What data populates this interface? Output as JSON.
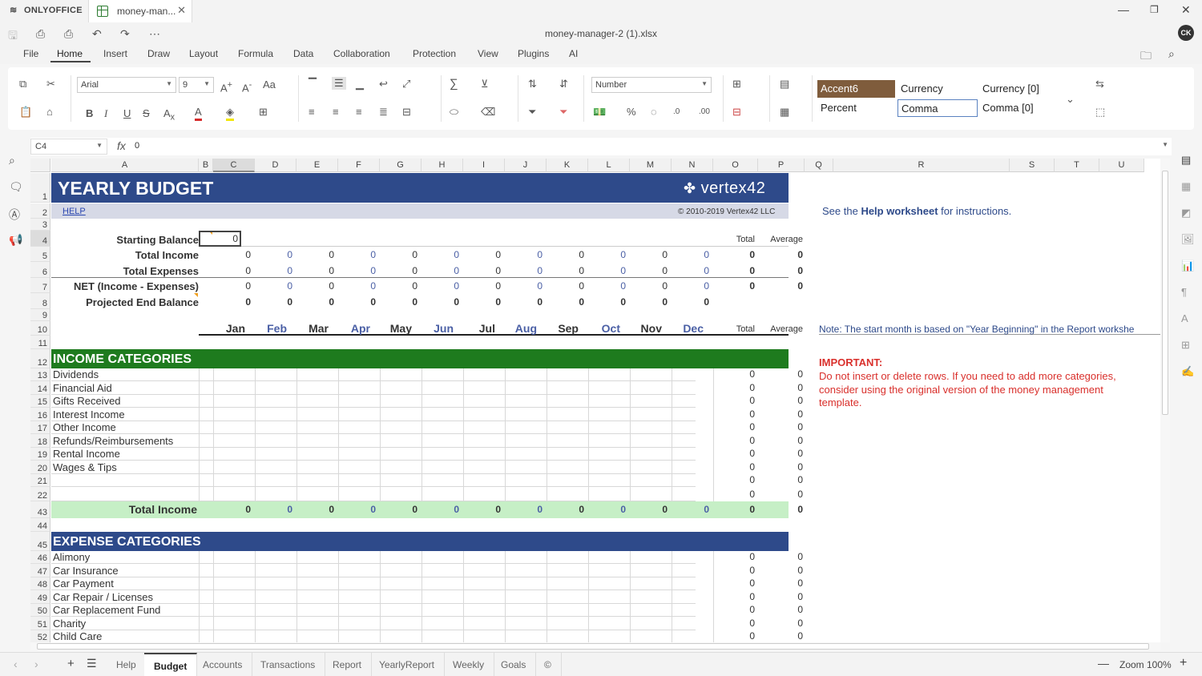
{
  "app": {
    "brand": "ONLYOFFICE",
    "doc_tab": "money-man...",
    "filename": "money-manager-2 (1).xlsx",
    "user_initials": "CK"
  },
  "menu": [
    "File",
    "Home",
    "Insert",
    "Draw",
    "Layout",
    "Formula",
    "Data",
    "Collaboration",
    "Protection",
    "View",
    "Plugins",
    "AI"
  ],
  "ribbon": {
    "font_name": "Arial",
    "font_size": "9",
    "number_format": "Number",
    "styles": [
      "Accent6",
      "Currency",
      "Currency [0]",
      "Percent",
      "Comma",
      "Comma [0]"
    ],
    "accent_color": "#7f5c3c"
  },
  "formula_bar": {
    "name_box": "C4",
    "fx": "fx",
    "value": "0"
  },
  "columns": [
    "A",
    "B",
    "C",
    "D",
    "E",
    "F",
    "G",
    "H",
    "I",
    "J",
    "K",
    "L",
    "M",
    "N",
    "O",
    "P",
    "Q",
    "R",
    "S",
    "T",
    "U"
  ],
  "rows": {
    "r1": "1",
    "r2": "2",
    "r3": "3",
    "r4": "4",
    "r5": "5",
    "r6": "6",
    "r7": "7",
    "r8": "8",
    "r9": "9",
    "r10": "10",
    "r11": "11",
    "r12": "12",
    "r13": "13",
    "r14": "14",
    "r15": "15",
    "r16": "16",
    "r17": "17",
    "r18": "18",
    "r19": "19",
    "r20": "20",
    "r21": "21",
    "r22": "22",
    "r43": "43",
    "r44": "44",
    "r45": "45",
    "r46": "46",
    "r47": "47",
    "r48": "48",
    "r49": "49",
    "r50": "50",
    "r51": "51",
    "r52": "52"
  },
  "sheet": {
    "title": "YEARLY BUDGET",
    "logo": "vertex42",
    "help_link": "HELP",
    "copyright": "© 2010-2019 Vertex42 LLC",
    "help_note_pre": "See the ",
    "help_note_bold": "Help worksheet",
    "help_note_post": " for instructions.",
    "summary_labels": [
      "Starting Balance",
      "Total Income",
      "Total Expenses",
      "NET (Income - Expenses)",
      "Projected End Balance"
    ],
    "total_label": "Total",
    "average_label": "Average",
    "starting_balance_value": "0",
    "months": [
      "Jan",
      "Feb",
      "Mar",
      "Apr",
      "May",
      "Jun",
      "Jul",
      "Aug",
      "Sep",
      "Oct",
      "Nov",
      "Dec"
    ],
    "zero": "0",
    "month_note_label": "Note",
    "month_note_text": ": The start month is based on \"Year Beginning\" in the Report workshe",
    "income_header": "INCOME CATEGORIES",
    "income_items": [
      "Dividends",
      "Financial Aid",
      "Gifts Received",
      "Interest Income",
      "Other Income",
      "Refunds/Reimbursements",
      "Rental Income",
      "Wages & Tips",
      "",
      ""
    ],
    "total_income_label": "Total Income",
    "important_title": "IMPORTANT:",
    "important_lines": [
      "Do not insert or delete rows. If you need to add more categories,",
      "consider using the original version of the money management",
      "template."
    ],
    "expense_header": "EXPENSE CATEGORIES",
    "expense_items": [
      "Alimony",
      "Car Insurance",
      "Car Payment",
      "Car Repair / Licenses",
      "Car Replacement Fund",
      "Charity",
      "Child Care"
    ],
    "colors": {
      "banner_blue": "#2e4a8a",
      "income_green": "#1e7b1e",
      "light_green": "#c6efc6",
      "subtitle_gray": "#d6d9e6",
      "important_red": "#d9302c"
    }
  },
  "sheet_tabs": [
    "Help",
    "Budget",
    "Accounts",
    "Transactions",
    "Report",
    "YearlyReport",
    "Weekly",
    "Goals",
    "©"
  ],
  "active_tab": "Budget",
  "zoom": "Zoom 100%"
}
